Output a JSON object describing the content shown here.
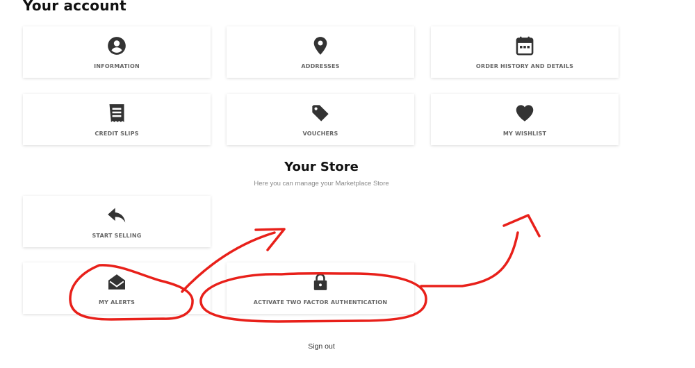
{
  "page_title": "Your account",
  "account_links": [
    {
      "label": "INFORMATION",
      "icon": "account-circle-icon"
    },
    {
      "label": "ADDRESSES",
      "icon": "location-pin-icon"
    },
    {
      "label": "ORDER HISTORY AND DETAILS",
      "icon": "calendar-icon"
    },
    {
      "label": "CREDIT SLIPS",
      "icon": "receipt-icon"
    },
    {
      "label": "VOUCHERS",
      "icon": "tag-icon"
    },
    {
      "label": "MY WISHLIST",
      "icon": "heart-icon"
    }
  ],
  "store": {
    "title": "Your Store",
    "subtitle": "Here you can manage your Marketplace Store",
    "links": [
      {
        "label": "START SELLING",
        "icon": "reply-arrow-icon"
      },
      {
        "label": "MY ALERTS",
        "icon": "open-envelope-icon"
      },
      {
        "label": "ACTIVATE TWO FACTOR AUTHENTICATION",
        "icon": "lock-icon"
      }
    ]
  },
  "sign_out": "Sign out",
  "colors": {
    "icon": "#333333",
    "label": "#666666",
    "annotation": "#e8201a"
  }
}
